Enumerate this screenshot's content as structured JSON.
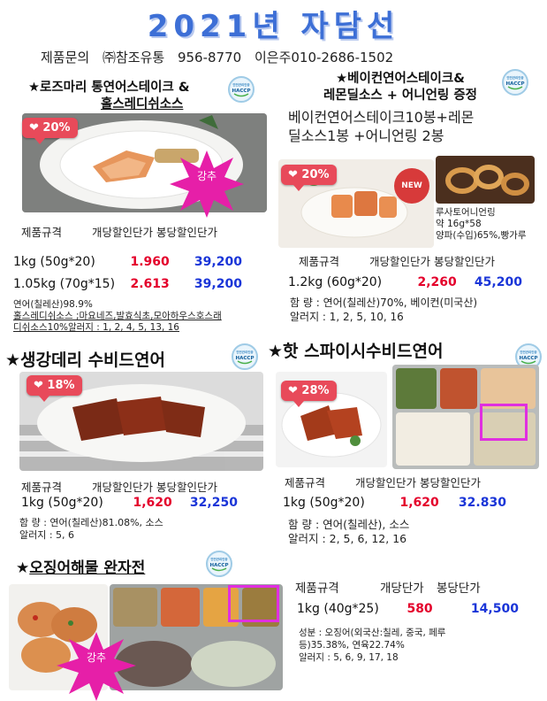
{
  "title": "2021년 자담선",
  "contact": {
    "label": "제품문의",
    "company": "㈜참조유통",
    "phone1": "956-8770",
    "person": "이은주",
    "phone2": "010-2686-1502"
  },
  "colors": {
    "title_blue": "#3d6fd6",
    "price_red": "#e4002b",
    "price_blue": "#1a35d8",
    "badge": "#e84a5a",
    "highlight": "#e02fe0",
    "burst": "#e61fa8"
  },
  "haccp": {
    "top": "안전관리인증",
    "main": "HACCP"
  },
  "table_headers": {
    "spec": "제품규격",
    "case": "개당할인단가",
    "bag": "봉당할인단가",
    "case2": "개당단가",
    "bag2": "봉당단가"
  },
  "p1": {
    "title_line1": "★로즈마리 통연어스테이크 &",
    "title_line2": "홀스레디쉬소스",
    "discount": "20%",
    "burst": "강추",
    "rows": [
      {
        "spec": "1kg (50g*20)",
        "unit": "1.960",
        "bag": "39,200"
      },
      {
        "spec": "1.05kg (70g*15)",
        "unit": "2.613",
        "bag": "39,200"
      }
    ],
    "ingredients": "연어(칠레산)98.9%",
    "sauce": "홀스레디쉬소스 ;마요네즈,발효식초,모아하우스호스래",
    "allergy": "디쉬소스10%알러지 : 1, 2, 4, 5, 13, 16"
  },
  "p2": {
    "title_line1": "★베이컨연어스테이크&",
    "title_line2": "레몬딜소스 + 어니언링 증정",
    "desc_line1": "베이컨연어스테이크10봉+레몬",
    "desc_line2": "딜소스1봉 +어니언링 2봉",
    "discount": "20%",
    "new_label": "NEW",
    "onion_name": "루사토어니언링",
    "onion_weight": "약 16g*58",
    "onion_origin": "양파(수입)65%,빵가루",
    "rows": [
      {
        "spec": "1.2kg (60g*20)",
        "unit": "2,260",
        "bag": "45,200"
      }
    ],
    "ingredients": "함 량 : 연어(칠레산)70%, 베이컨(미국산)",
    "allergy": "알러지 : 1, 2, 5, 10, 16"
  },
  "p3": {
    "title": "★생강데리 수비드연어",
    "discount": "18%",
    "rows": [
      {
        "spec": "1kg (50g*20)",
        "unit": "1,620",
        "bag": "32,250"
      }
    ],
    "ingredients": "함 량 : 연어(칠레산)81.08%, 소스",
    "allergy": "알러지 : 5, 6"
  },
  "p4": {
    "title": "★핫 스파이시수비드연어",
    "discount": "28%",
    "rows": [
      {
        "spec": "1kg (50g*20)",
        "unit": "1,620",
        "bag": "32.830"
      }
    ],
    "ingredients": "함 량 : 연어(칠레산), 소스",
    "allergy": "알러지 : 2, 5, 6, 12, 16"
  },
  "p5": {
    "title_star": "★",
    "title": "오징어해물 완자전",
    "burst": "강추",
    "rows": [
      {
        "spec": "1kg (40g*25)",
        "unit": "580",
        "bag": "14,500"
      }
    ],
    "ingredients_line1": "성분 : 오징어(외국산:칠레, 중국, 페루",
    "ingredients_line2": "등)35.38%, 연육22.74%",
    "allergy": "알러지 : 5, 6, 9, 17, 18"
  }
}
